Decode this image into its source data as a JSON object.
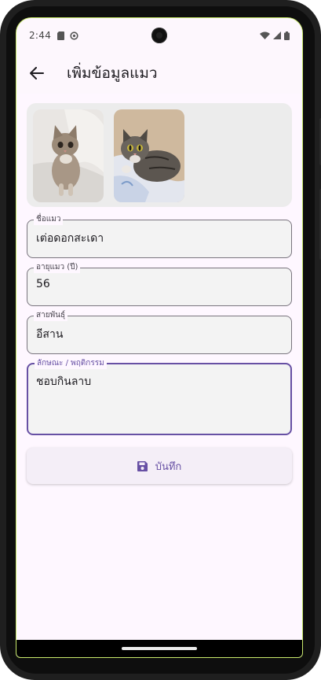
{
  "status_bar": {
    "time": "2:44",
    "left_icons": [
      "sd-card-icon",
      "sync-icon"
    ],
    "right_icons": [
      "wifi-icon",
      "signal-icon",
      "battery-icon"
    ]
  },
  "app_bar": {
    "title": "เพิ่มข้อมูลแมว",
    "back_icon": "arrow-back-icon"
  },
  "images": [
    {
      "name": "cat-photo-1",
      "description_icon": "photo"
    },
    {
      "name": "cat-photo-2",
      "description_icon": "photo"
    }
  ],
  "fields": {
    "name": {
      "label": "ชื่อแมว",
      "value": "เต่อดอกสะเดา"
    },
    "age": {
      "label": "อายุแมว (ปี)",
      "value": "56"
    },
    "breed": {
      "label": "สายพันธุ์",
      "value": "อีสาน"
    },
    "traits": {
      "label": "ลักษณะ / พฤติกรรม",
      "value": "ชอบกินลาบ"
    }
  },
  "save_button": {
    "label": "บันทึก",
    "icon": "save-icon"
  },
  "colors": {
    "accent": "#6750a4",
    "background": "#fef7ff",
    "field_fill": "#f3f3f3"
  }
}
